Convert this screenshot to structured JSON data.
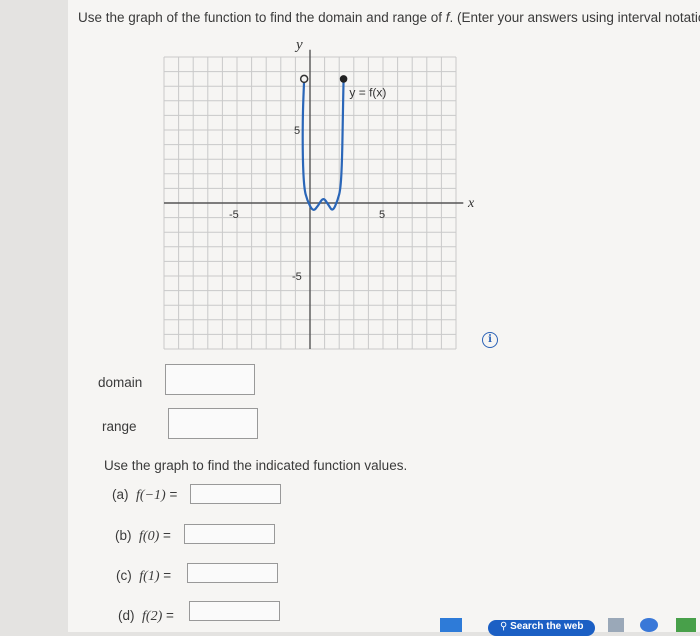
{
  "question": {
    "text_before": "Use the graph of the function to find the domain and range of ",
    "func_letter": "f",
    "text_after": ". (Enter your answers using interval notation.)"
  },
  "graph": {
    "x_axis_label": "x",
    "y_axis_label": "y",
    "function_label": "y = f(x)",
    "tick_x_neg": "-5",
    "tick_x_pos": "5",
    "tick_y_pos": "5",
    "tick_y_neg": "-5",
    "curve_points": [
      [
        -0.4,
        8.5
      ],
      [
        -0.5,
        6
      ],
      [
        -0.5,
        3
      ],
      [
        -0.4,
        1
      ],
      [
        -0.2,
        0.2
      ],
      [
        0.2,
        -0.6
      ],
      [
        0.55,
        -0.2
      ],
      [
        0.9,
        0.4
      ],
      [
        1.25,
        -0.1
      ],
      [
        1.55,
        -0.6
      ],
      [
        1.9,
        0.2
      ],
      [
        2.1,
        1
      ],
      [
        2.2,
        3
      ],
      [
        2.25,
        6
      ],
      [
        2.3,
        8.5
      ]
    ],
    "open_point": [
      -0.4,
      8.5
    ],
    "closed_point": [
      2.3,
      8.5
    ]
  },
  "info_icon": "i",
  "domain_label": "domain",
  "range_label": "range",
  "values_prompt": "Use the graph to find the indicated function values.",
  "subquestions": [
    {
      "part": "(a)",
      "expr": "f(−1)",
      "eq": "="
    },
    {
      "part": "(b)",
      "expr": "f(0)",
      "eq": "="
    },
    {
      "part": "(c)",
      "expr": "f(1)",
      "eq": "="
    },
    {
      "part": "(d)",
      "expr": "f(2)",
      "eq": "="
    }
  ],
  "taskbar": {
    "search_label": "Search the web"
  }
}
